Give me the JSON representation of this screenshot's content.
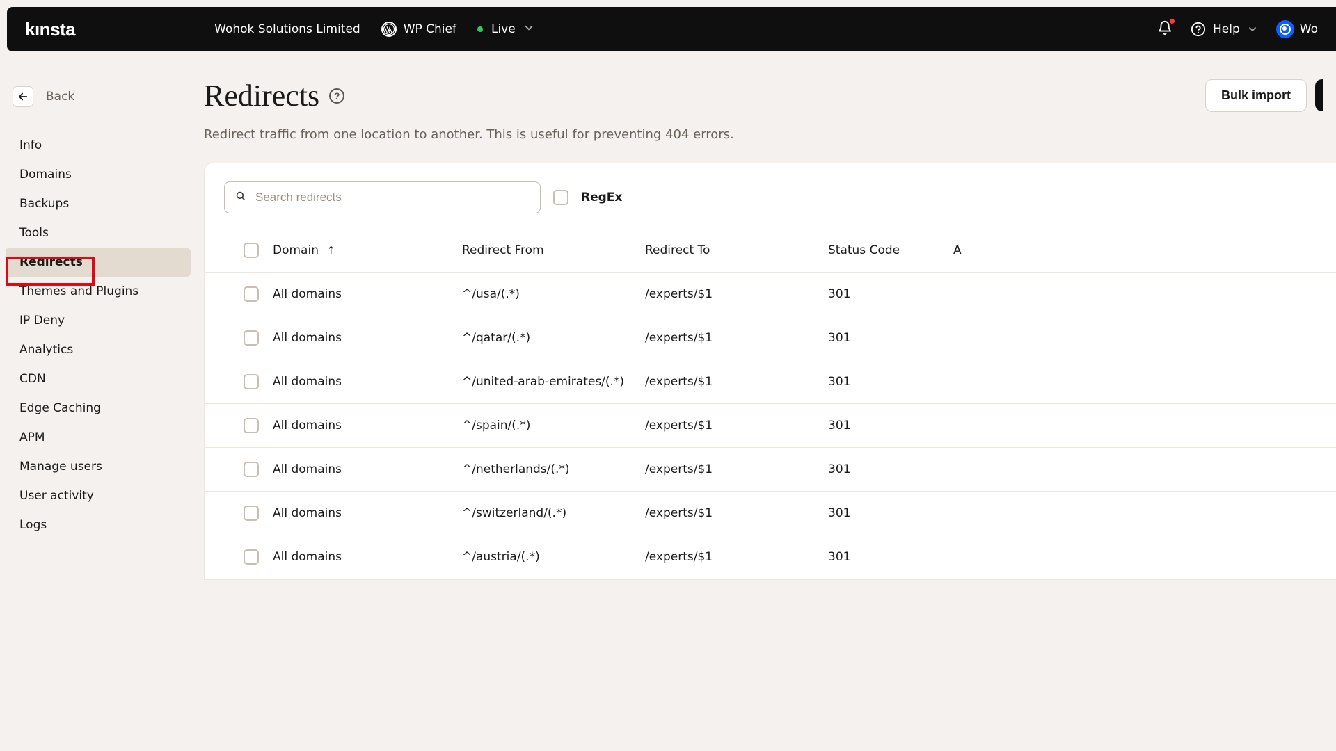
{
  "topbar": {
    "logo": "kınsta",
    "company": "Wohok Solutions Limited",
    "site": "WP Chief",
    "env": "Live",
    "help": "Help",
    "user_short": "Wo"
  },
  "back": {
    "label": "Back"
  },
  "sidebar": {
    "items": [
      {
        "label": "Info"
      },
      {
        "label": "Domains"
      },
      {
        "label": "Backups"
      },
      {
        "label": "Tools"
      },
      {
        "label": "Redirects",
        "active": true
      },
      {
        "label": "Themes and Plugins"
      },
      {
        "label": "IP Deny"
      },
      {
        "label": "Analytics"
      },
      {
        "label": "CDN"
      },
      {
        "label": "Edge Caching"
      },
      {
        "label": "APM"
      },
      {
        "label": "Manage users"
      },
      {
        "label": "User activity"
      },
      {
        "label": "Logs"
      }
    ]
  },
  "main": {
    "title": "Redirects",
    "description": "Redirect traffic from one location to another. This is useful for preventing 404 errors.",
    "bulk_import": "Bulk import",
    "search_placeholder": "Search redirects",
    "regex_label": "RegEx",
    "columns": {
      "domain": "Domain",
      "from": "Redirect From",
      "to": "Redirect To",
      "status": "Status Code",
      "actions": "A"
    },
    "rows": [
      {
        "domain": "All domains",
        "from": "^/usa/(.*)",
        "to": "/experts/$1",
        "status": "301"
      },
      {
        "domain": "All domains",
        "from": "^/qatar/(.*)",
        "to": "/experts/$1",
        "status": "301"
      },
      {
        "domain": "All domains",
        "from": "^/united-arab-emirates/(.*)",
        "to": "/experts/$1",
        "status": "301"
      },
      {
        "domain": "All domains",
        "from": "^/spain/(.*)",
        "to": "/experts/$1",
        "status": "301"
      },
      {
        "domain": "All domains",
        "from": "^/netherlands/(.*)",
        "to": "/experts/$1",
        "status": "301"
      },
      {
        "domain": "All domains",
        "from": "^/switzerland/(.*)",
        "to": "/experts/$1",
        "status": "301"
      },
      {
        "domain": "All domains",
        "from": "^/austria/(.*)",
        "to": "/experts/$1",
        "status": "301"
      }
    ]
  }
}
